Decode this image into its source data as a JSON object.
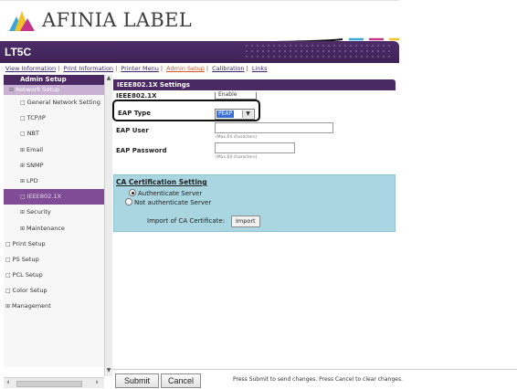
{
  "brand": {
    "logo_text": "AFINIA LABEL"
  },
  "header": {
    "model": "LT5C"
  },
  "nav": {
    "items": [
      {
        "label": "View Information",
        "active": false
      },
      {
        "label": "Print Information",
        "active": false
      },
      {
        "label": "Printer Menu",
        "active": false
      },
      {
        "label": "Admin Setup",
        "active": true
      },
      {
        "label": "Calibration",
        "active": false
      },
      {
        "label": "Links",
        "active": false
      }
    ]
  },
  "sidebar": {
    "header": "Admin Setup",
    "section": "Network Setup",
    "items": [
      {
        "label": "General Network Setting",
        "bullet": "□"
      },
      {
        "label": "TCP/IP",
        "bullet": "□"
      },
      {
        "label": "NBT",
        "bullet": "□"
      },
      {
        "label": "Email",
        "bullet": "⊞"
      },
      {
        "label": "SNMP",
        "bullet": "⊞"
      },
      {
        "label": "LPD",
        "bullet": "⊞"
      },
      {
        "label": "IEEE802.1X",
        "bullet": "□"
      },
      {
        "label": "Security",
        "bullet": "⊞"
      },
      {
        "label": "Maintenance",
        "bullet": "⊞"
      }
    ],
    "top_items": [
      {
        "label": "Print Setup",
        "bullet": "□"
      },
      {
        "label": "PS Setup",
        "bullet": "□"
      },
      {
        "label": "PCL Setup",
        "bullet": "□"
      },
      {
        "label": "Color Setup",
        "bullet": "□"
      },
      {
        "label": "Management",
        "bullet": "⊞"
      }
    ]
  },
  "panel": {
    "title": "IEEE802.1X Settings",
    "ieee_label": "IEEE802.1X",
    "ieee_value": "Enable",
    "eap_type_label": "EAP Type",
    "eap_type_value": "PEAP",
    "eap_user_label": "EAP User",
    "eap_user_hint": "(Max.64 characters)",
    "eap_password_label": "EAP Password",
    "eap_password_hint": "(Max.64 characters)"
  },
  "ca": {
    "title": "CA Certification Setting",
    "option_authenticate": "Authenticate Server",
    "option_not": "Not authenticate Server",
    "selected": "authenticate",
    "import_label": "Import of CA Certificate:",
    "import_button": "Import"
  },
  "footer": {
    "submit": "Submit",
    "cancel": "Cancel",
    "message": "Press Submit to send changes. Press Cancel to clear changes."
  },
  "colors": {
    "brand_purple": "#4b2a64",
    "selected_purple": "#7f4c95",
    "ca_panel": "#aad6e2",
    "accent_orange": "#d05a2a"
  }
}
